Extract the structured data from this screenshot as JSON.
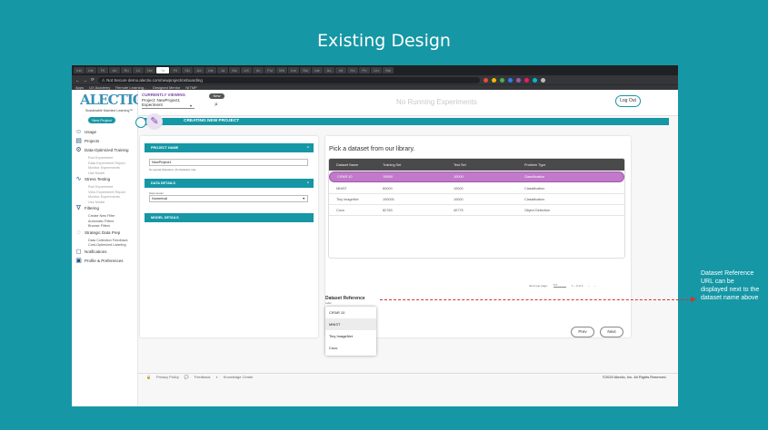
{
  "slide": {
    "title": "Existing Design",
    "annotation": "Dataset Reference URL can be displayed next to the dataset name above",
    "annotation_color": "#d6332a"
  },
  "browser": {
    "tabs": [
      "Inb",
      "Ide",
      "Fil",
      "Ari",
      "Ru",
      "Lil",
      "Nic",
      "Ta",
      "Fri",
      "Ski",
      "Ad",
      "Ide",
      "Ja",
      "Mc",
      "UX",
      "Ar",
      "Ful",
      "Wh",
      "Ind",
      "Ski",
      "Ide",
      "Ac",
      "Inf",
      "Ho",
      "Pri",
      "Lin",
      "Ste"
    ],
    "address": "demo.alectio.com/newproject/onboarding",
    "security_label": "Not Secure",
    "bookmarks": [
      "Apps",
      "UX Academy",
      "Remote Learning…",
      "Designed Mentor",
      "NITMP"
    ]
  },
  "sidebar": {
    "logo_text": "ALECTIO",
    "logo_tagline": "Sustainable Machine Learning™",
    "new_project_label": "New Project",
    "nav": [
      {
        "icon": "user-icon",
        "label": "Usage",
        "subs": []
      },
      {
        "icon": "folder-icon",
        "label": "Projects",
        "subs": []
      },
      {
        "icon": "gear-icon",
        "label": "Data-Optimized Training",
        "subs": [
          "Run Experiment",
          "Data Experiment Report",
          "Monitor Experiments",
          "Use Model"
        ]
      },
      {
        "icon": "chart-icon",
        "label": "Stress Testing",
        "subs": [
          "Run Experiment",
          "View Experiment Report",
          "Monitor Experiments",
          "Use Model"
        ]
      },
      {
        "icon": "filter-icon",
        "label": "Filtering",
        "subs": [
          "Create New Filter",
          "Automatic Filters",
          "Browse Filters"
        ]
      },
      {
        "icon": "lightbulb-icon",
        "label": "Strategic Data Prep",
        "subs": [
          "Data Collection Feedback",
          "Cost-Optimized Labeling"
        ]
      },
      {
        "icon": "bell-icon",
        "label": "Notifications",
        "subs": []
      },
      {
        "icon": "profile-icon",
        "label": "Profile & Preferences",
        "subs": []
      }
    ]
  },
  "topbar": {
    "currently_viewing": "CURRENTLY VIEWING",
    "project": "Project: NewProject1",
    "experiment": "Experiment",
    "new_label": "New",
    "status": "No Running Experiments",
    "logout_label": "Log Out"
  },
  "banner": {
    "title": "CREATING NEW PROJECT"
  },
  "form": {
    "sections": {
      "project_name": "PROJECT NAME",
      "data_details": "DATA DETAILS",
      "model_details": "MODEL DETAILS"
    },
    "project_name_value": "NewProject1",
    "project_name_hint": "No special characters, 20 characters max.",
    "data_type_label": "Data Header",
    "data_type_value": "Numerical"
  },
  "dataset": {
    "title": "Pick a dataset from our library.",
    "columns": [
      "Dataset Name",
      "Training Set",
      "Test Set",
      "Problem Type"
    ],
    "rows": [
      [
        "CIFAR 10",
        "50000",
        "10000",
        "Classification"
      ],
      [
        "MNIST",
        "60000",
        "10000",
        "Classification"
      ],
      [
        "Tiny ImageNet",
        "100000",
        "10000",
        "Classification"
      ],
      [
        "Coco",
        "82783",
        "40775",
        "Object Detection"
      ]
    ],
    "selected_row": 0,
    "selected_color": "#c07ac9",
    "items_per_page_label": "Items per page:",
    "items_per_page_value": "5",
    "page_range": "1 – 4 of 4",
    "reference_title": "Dataset Reference",
    "reference_sub": "Label",
    "reference_options": [
      "CIFAR 10",
      "MNIST",
      "Tiny ImageNet",
      "Coco"
    ],
    "prev_label": "Prev",
    "next_label": "Next"
  },
  "footer": {
    "privacy": "Privacy Policy",
    "feedback": "Feedback",
    "knowledge": "Knowledge Center",
    "copyright": "©2020 Alectio, Inc. All Rights Reserved."
  },
  "colors": {
    "brand_teal": "#1597a5",
    "accent_purple": "#7a4ba8"
  }
}
